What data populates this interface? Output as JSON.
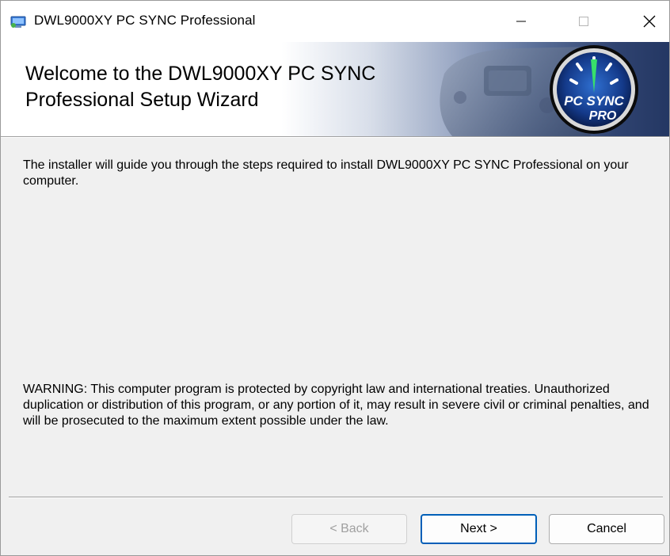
{
  "window": {
    "title": "DWL9000XY PC SYNC Professional",
    "controls": {
      "minimize": "—",
      "maximize": "□",
      "close": "✕"
    }
  },
  "banner": {
    "title_line1": "Welcome to the DWL9000XY PC SYNC",
    "title_line2": "Professional Setup Wizard",
    "logo": {
      "line1": "PC SYNC",
      "line2": "PRO"
    }
  },
  "body": {
    "intro": "The installer will guide you through the steps required to install DWL9000XY PC SYNC Professional on your computer.",
    "warning": "WARNING: This computer program is protected by copyright law and international treaties. Unauthorized duplication or distribution of this program, or any portion of it, may result in severe civil or criminal penalties, and will be prosecuted to the maximum extent possible under the law."
  },
  "buttons": {
    "back": "< Back",
    "next": "Next >",
    "cancel": "Cancel"
  },
  "colors": {
    "accent": "#005fb8",
    "banner_dark": "#243763",
    "logo_text": "#ffffff"
  }
}
